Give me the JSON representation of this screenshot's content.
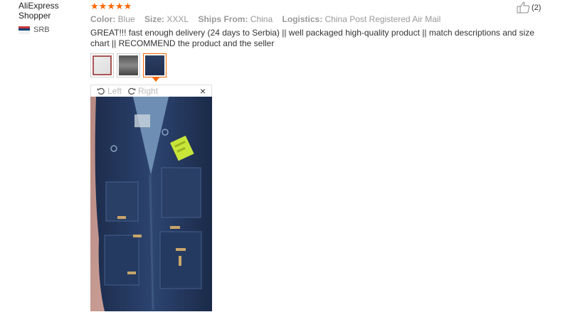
{
  "user": {
    "name": "AliExpress Shopper",
    "country_code": "SRB"
  },
  "review": {
    "rating": 5,
    "attributes": [
      {
        "label": "Color:",
        "value": "Blue"
      },
      {
        "label": "Size:",
        "value": "XXXL"
      },
      {
        "label": "Ships From:",
        "value": "China"
      },
      {
        "label": "Logistics:",
        "value": "China Post Registered Air Mail"
      }
    ],
    "text": "GREAT!!! fast enough delivery (24 days to Serbia) || well packaged high-quality product || match descriptions and size chart || RECOMMEND the product and the seller"
  },
  "helpful": {
    "count": "(2)"
  },
  "viewer": {
    "rotate_left": "Left",
    "rotate_right": "Right",
    "close": "×"
  },
  "colors": {
    "star": "#ff6600",
    "active_border": "#ff6600"
  }
}
